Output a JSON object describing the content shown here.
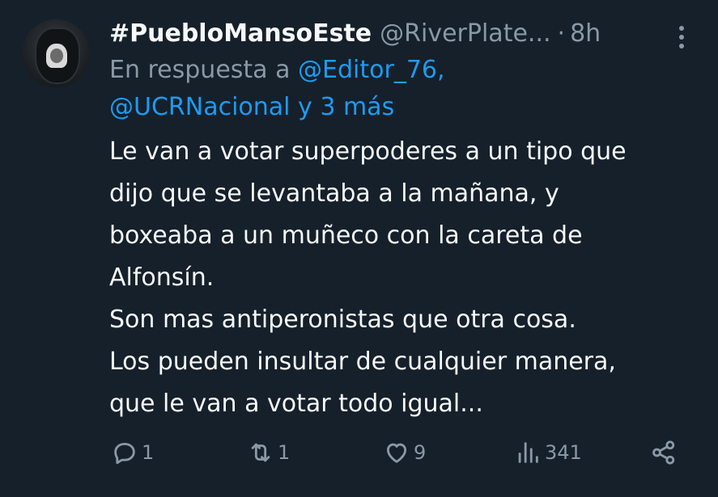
{
  "author": {
    "display_name": "#PuebloMansoEste",
    "handle": "@RiverPlate...",
    "separator": "·",
    "time": "8h"
  },
  "reply": {
    "prefix": "En respuesta a",
    "mention_1": "@Editor_76,",
    "mention_2": "@UCRNacional",
    "others": "y 3 más"
  },
  "body": {
    "lines": [
      "Le van a votar superpoderes a un tipo que",
      "dijo que se levantaba a la mañana, y",
      "boxeaba a un muñeco con la careta de",
      "Alfonsín.",
      "Son mas antiperonistas que otra cosa.",
      "Los pueden insultar de cualquier manera,",
      "que le van a votar todo igual..."
    ]
  },
  "actions": {
    "replies": "1",
    "reposts": "1",
    "likes": "9",
    "views": "341"
  },
  "icons": {
    "more": "more-vertical-icon",
    "reply": "reply-icon",
    "repost": "repost-icon",
    "like": "heart-icon",
    "views": "views-icon",
    "share": "share-icon"
  },
  "colors": {
    "background": "#15202b",
    "text": "#f7f9f9",
    "muted": "#8b98a5",
    "accent": "#1d9bf0"
  }
}
